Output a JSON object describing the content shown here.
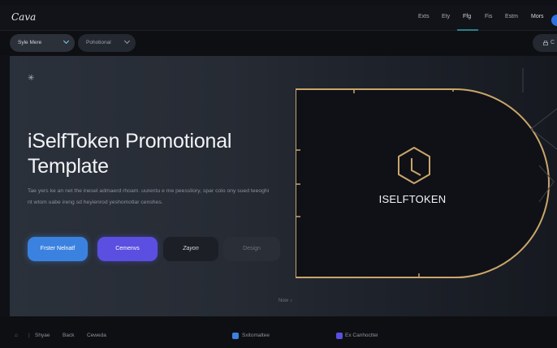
{
  "topbar": {
    "logo": "Cava",
    "menu": [
      "Exts",
      "Ety",
      "Ffg",
      "Fis",
      "Estm",
      "Mors"
    ],
    "active_index": 2
  },
  "subbar": {
    "style_dropdown": "Syle Mere",
    "type_dropdown": "Pohotional",
    "share_label": "C"
  },
  "canvas": {
    "sparkle": "✳",
    "title": "iSelfToken Promotional Template",
    "description": "Tae yers ke an net the inesel admaerd rhoam. uurentu e me peessliory, spar colo ony sued teeoghi nt wtom uabe ireng sd heyienrod yeshomotlar censhes.",
    "buttons": {
      "primary": "Frster Nelnatf",
      "purple": "Cemenvs",
      "dark": "Zayon",
      "ghost": "Design"
    },
    "hint": "Now"
  },
  "card": {
    "brand_name": "ISELFTOKEN",
    "icon": "hexagon-clock-icon"
  },
  "bottombar": {
    "home_icon": "home-icon",
    "items": [
      "Shyae",
      "Back",
      "Ceweda"
    ],
    "middle": "Sxitomaltee",
    "right": "Ex Canhocttei"
  },
  "colors": {
    "accent_blue": "#3b82e0",
    "accent_purple": "#5a4fe0",
    "gold": "#c9a66b",
    "tab_underline": "#2a7f8a"
  }
}
